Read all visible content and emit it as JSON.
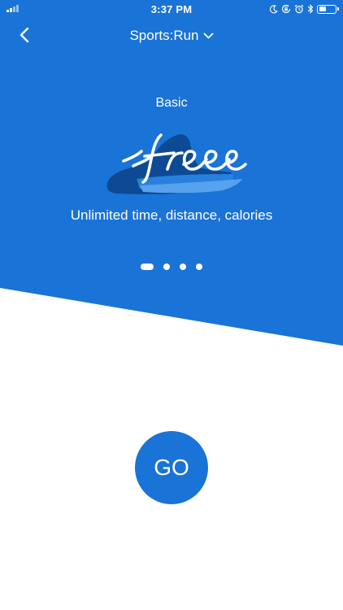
{
  "colors": {
    "primary": "#1a73d6",
    "shoe_dark": "#0d4a93",
    "shoe_mid": "#2880de",
    "shoe_light": "#56a2ee",
    "text_on_primary": "#ffffff",
    "background": "#ffffff"
  },
  "status_bar": {
    "time": "3:37 PM",
    "icons": [
      "signal-icon",
      "moon-icon",
      "rotation-lock-icon",
      "alarm-icon",
      "bluetooth-icon",
      "battery-icon"
    ]
  },
  "nav": {
    "back_icon": "chevron-left-icon",
    "title": "Sports:Run",
    "dropdown_icon": "chevron-down-icon"
  },
  "plan": {
    "title": "Basic",
    "badge_text": "free",
    "description": "Unlimited time, distance, calories"
  },
  "pager": {
    "count": 4,
    "active_index": 0
  },
  "go_button": {
    "label": "GO"
  }
}
